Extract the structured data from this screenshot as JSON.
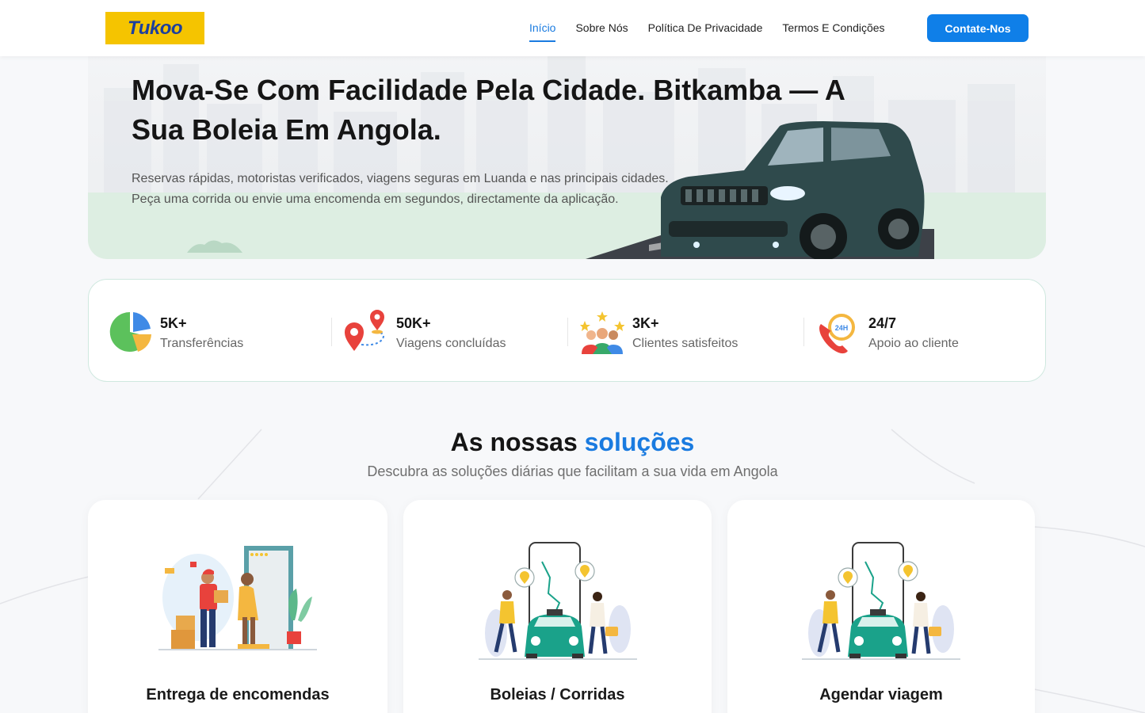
{
  "header": {
    "logo_text": "Tuk",
    "logo_text_suffix": "oo",
    "nav": [
      {
        "label": "Início",
        "active": true
      },
      {
        "label": "Sobre Nós",
        "active": false
      },
      {
        "label": "Política De Privacidade",
        "active": false
      },
      {
        "label": "Termos E Condições",
        "active": false
      }
    ],
    "cta_label": "Contate-Nos"
  },
  "hero": {
    "title": "Mova-Se Com Facilidade Pela Cidade. Bitkamba — A Sua Boleia Em Angola.",
    "description": "Reservas rápidas, motoristas verificados, viagens seguras em Luanda e nas principais cidades. Peça uma corrida ou envie uma encomenda em segundos, directamente da aplicação."
  },
  "stats": [
    {
      "value": "5K+",
      "label": "Transferências",
      "icon": "pie-chart-icon"
    },
    {
      "value": "50K+",
      "label": "Viagens concluídas",
      "icon": "route-pins-icon"
    },
    {
      "value": "3K+",
      "label": "Clientes satisfeitos",
      "icon": "happy-customers-icon"
    },
    {
      "value": "24/7",
      "label": "Apoio ao cliente",
      "icon": "phone-24h-icon"
    }
  ],
  "solutions": {
    "title": "As nossas",
    "title_highlight": "soluções",
    "subtitle": "Descubra as soluções diárias que facilitam a sua vida em Angola",
    "cards": [
      {
        "title": "Entrega de encomendas",
        "icon": "delivery-illustration"
      },
      {
        "title": "Boleias / Corridas",
        "icon": "taxi-app-illustration"
      },
      {
        "title": "Agendar viagem",
        "icon": "schedule-trip-illustration"
      }
    ]
  },
  "colors": {
    "accent": "#0f7fe8",
    "logo_bg": "#f5c400",
    "hero_ground": "#ddeee2",
    "stats_border": "#cfe8df"
  }
}
